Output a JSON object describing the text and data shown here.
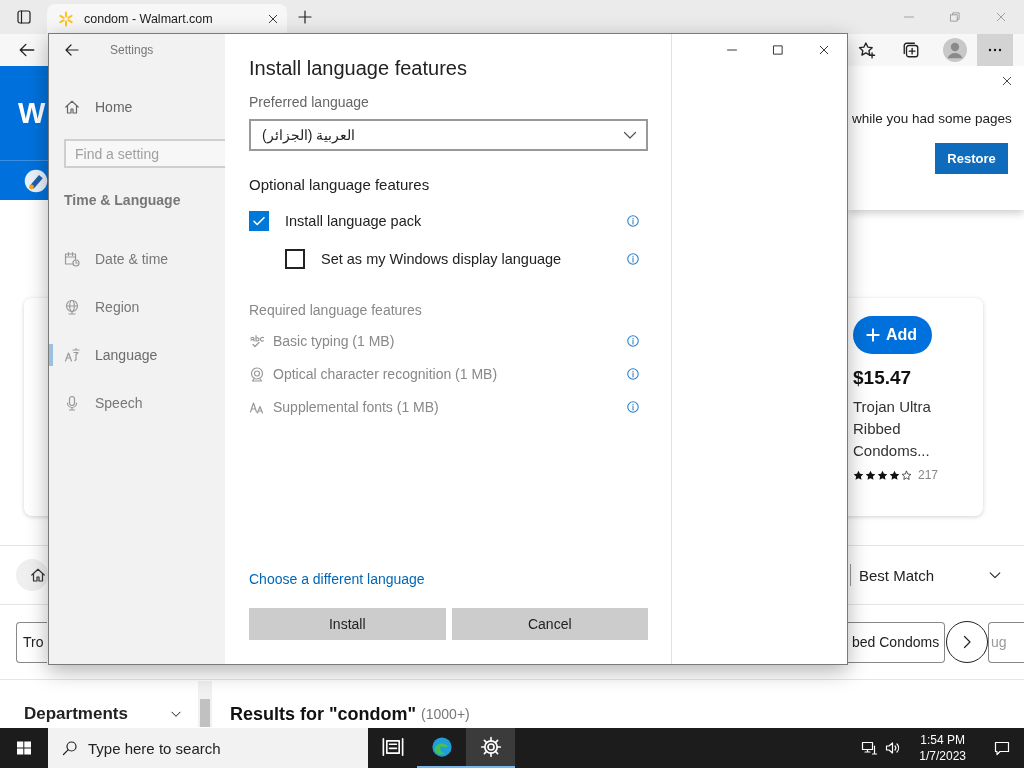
{
  "browser": {
    "tab": {
      "title": "condom - Walmart.com"
    }
  },
  "page": {
    "logo_text": "W",
    "restore_popup": {
      "message": "while you had some pages",
      "button": "Restore"
    },
    "product": {
      "add_button": "Add",
      "price": "$15.47",
      "name": "Trojan Ultra Ribbed Condoms...",
      "stars": 4,
      "review_count": "217"
    },
    "sort": {
      "label": "Best Match"
    },
    "chips": [
      {
        "label": "Tro",
        "kind": "left"
      },
      {
        "label": "bed Condoms",
        "kind": "right"
      },
      {
        "label": "ug",
        "kind": "edge"
      }
    ],
    "departments": "Departments",
    "results": {
      "heading": "Results for \"condom\"",
      "count": "(1000+)"
    }
  },
  "settings": {
    "title": "Settings",
    "home": "Home",
    "search": {
      "placeholder": "Find a setting"
    },
    "section": "Time & Language",
    "nav": [
      {
        "label": "Date & time",
        "kind": "clock",
        "selected": false
      },
      {
        "label": "Region",
        "kind": "globe",
        "selected": false
      },
      {
        "label": "Language",
        "kind": "language",
        "selected": true
      },
      {
        "label": "Speech",
        "kind": "mic",
        "selected": false
      }
    ],
    "dialog": {
      "title": "Install language features",
      "preferred_label": "Preferred language",
      "preferred_value": "العربية (الجزائر)",
      "optional_heading": "Optional language features",
      "options": [
        {
          "label": "Install language pack",
          "checked": true,
          "children": [
            {
              "label": "Set as my Windows display language",
              "checked": false
            }
          ]
        }
      ],
      "required_heading": "Required language features",
      "required": [
        {
          "label": "Basic typing (1 MB)",
          "kind": "typing"
        },
        {
          "label": "Optical character recognition (1 MB)",
          "kind": "ocr"
        },
        {
          "label": "Supplemental fonts (1 MB)",
          "kind": "fonts"
        }
      ],
      "link": "Choose a different language",
      "buttons": [
        "Install",
        "Cancel"
      ]
    }
  },
  "taskbar": {
    "search_placeholder": "Type here to search",
    "apps": [
      {
        "kind": "taskview",
        "open": false,
        "selected": false
      },
      {
        "kind": "edge",
        "open": true,
        "selected": false
      },
      {
        "kind": "settings",
        "open": true,
        "selected": true
      }
    ],
    "time": "1:54 PM",
    "date": "1/7/2023"
  }
}
